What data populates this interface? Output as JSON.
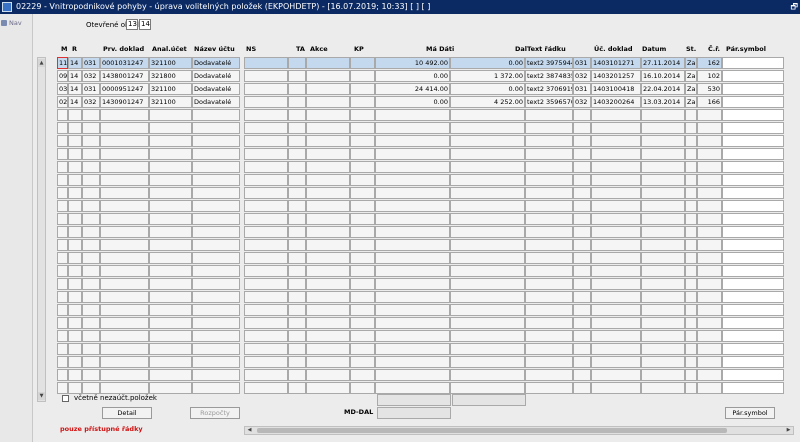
{
  "window": {
    "title": "02229 - Vnitropodnikové pohyby - úprava volitelných položek (EKPOHDETP) - [16.07.2019; 10:33]  [ ]  [ ]",
    "restore_glyph": "🗗"
  },
  "nav": {
    "label": "Nav"
  },
  "period": {
    "label": "Otevřené období",
    "value1": "13",
    "value2": "14"
  },
  "columns": {
    "m": "M",
    "r": "R",
    "prv_doklad": "Prv. doklad",
    "anal_ucet": "Anal.účet",
    "nazev_uctu": "Název účtu",
    "ns": "NS",
    "ta": "TA",
    "akce": "Akce",
    "kp": "KP",
    "ma_dati": "Má Dáti",
    "dal": "Dal",
    "text_radku": "Text řádku",
    "uc_doklad": "Úč. doklad",
    "datum": "Datum",
    "st": "St.",
    "cr": "Č.ř.",
    "par_symbol": "Pár.symbol"
  },
  "rows": [
    {
      "m": "11",
      "r": "14",
      "typ": "031",
      "prv_doklad": "0001031247",
      "anal_ucet": "321100",
      "nazev_uctu": "Dodavatelé",
      "ma_dati": "10 492.00",
      "dal": "0.00",
      "text": "text2 3975944",
      "kod": "031",
      "uc_doklad": "1403101271",
      "datum": "27.11.2014",
      "st": "Za",
      "cr": "162"
    },
    {
      "m": "09",
      "r": "14",
      "typ": "032",
      "prv_doklad": "1438001247",
      "anal_ucet": "321800",
      "nazev_uctu": "Dodavatelé",
      "ma_dati": "0.00",
      "dal": "1 372.00",
      "text": "text2 3874835",
      "kod": "032",
      "uc_doklad": "1403201257",
      "datum": "16.10.2014",
      "st": "Za",
      "cr": "102"
    },
    {
      "m": "03",
      "r": "14",
      "typ": "031",
      "prv_doklad": "0000951247",
      "anal_ucet": "321100",
      "nazev_uctu": "Dodavatelé",
      "ma_dati": "24 414.00",
      "dal": "0.00",
      "text": "text2 3706919",
      "kod": "031",
      "uc_doklad": "1403100418",
      "datum": "22.04.2014",
      "st": "Za",
      "cr": "530"
    },
    {
      "m": "02",
      "r": "14",
      "typ": "032",
      "prv_doklad": "1430901247",
      "anal_ucet": "321100",
      "nazev_uctu": "Dodavatelé",
      "ma_dati": "0.00",
      "dal": "4 252.00",
      "text": "text2 3596570",
      "kod": "032",
      "uc_doklad": "1403200264",
      "datum": "13.03.2014",
      "st": "Za",
      "cr": "166"
    }
  ],
  "footer": {
    "checkbox_label": "včetně nezaúčt.položek",
    "detail_button": "Detail",
    "rozpocty_button": "Rozpočty",
    "md_dal_label": "MD-DAL",
    "par_symbol_button": "Pár.symbol",
    "note": "pouze přístupné řádky"
  },
  "colors": {
    "titlebar": "#0b2a64",
    "selected_row": "#c5d9ee",
    "note": "#d01010"
  }
}
